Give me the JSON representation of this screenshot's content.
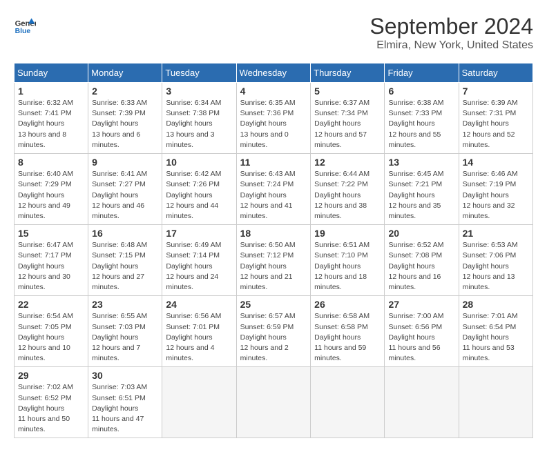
{
  "header": {
    "logo": {
      "line1": "General",
      "line2": "Blue"
    },
    "title": "September 2024",
    "subtitle": "Elmira, New York, United States"
  },
  "columns": [
    "Sunday",
    "Monday",
    "Tuesday",
    "Wednesday",
    "Thursday",
    "Friday",
    "Saturday"
  ],
  "weeks": [
    [
      {
        "day": "1",
        "sunrise": "6:32 AM",
        "sunset": "7:41 PM",
        "daylight": "13 hours and 8 minutes."
      },
      {
        "day": "2",
        "sunrise": "6:33 AM",
        "sunset": "7:39 PM",
        "daylight": "13 hours and 6 minutes."
      },
      {
        "day": "3",
        "sunrise": "6:34 AM",
        "sunset": "7:38 PM",
        "daylight": "13 hours and 3 minutes."
      },
      {
        "day": "4",
        "sunrise": "6:35 AM",
        "sunset": "7:36 PM",
        "daylight": "13 hours and 0 minutes."
      },
      {
        "day": "5",
        "sunrise": "6:37 AM",
        "sunset": "7:34 PM",
        "daylight": "12 hours and 57 minutes."
      },
      {
        "day": "6",
        "sunrise": "6:38 AM",
        "sunset": "7:33 PM",
        "daylight": "12 hours and 55 minutes."
      },
      {
        "day": "7",
        "sunrise": "6:39 AM",
        "sunset": "7:31 PM",
        "daylight": "12 hours and 52 minutes."
      }
    ],
    [
      {
        "day": "8",
        "sunrise": "6:40 AM",
        "sunset": "7:29 PM",
        "daylight": "12 hours and 49 minutes."
      },
      {
        "day": "9",
        "sunrise": "6:41 AM",
        "sunset": "7:27 PM",
        "daylight": "12 hours and 46 minutes."
      },
      {
        "day": "10",
        "sunrise": "6:42 AM",
        "sunset": "7:26 PM",
        "daylight": "12 hours and 44 minutes."
      },
      {
        "day": "11",
        "sunrise": "6:43 AM",
        "sunset": "7:24 PM",
        "daylight": "12 hours and 41 minutes."
      },
      {
        "day": "12",
        "sunrise": "6:44 AM",
        "sunset": "7:22 PM",
        "daylight": "12 hours and 38 minutes."
      },
      {
        "day": "13",
        "sunrise": "6:45 AM",
        "sunset": "7:21 PM",
        "daylight": "12 hours and 35 minutes."
      },
      {
        "day": "14",
        "sunrise": "6:46 AM",
        "sunset": "7:19 PM",
        "daylight": "12 hours and 32 minutes."
      }
    ],
    [
      {
        "day": "15",
        "sunrise": "6:47 AM",
        "sunset": "7:17 PM",
        "daylight": "12 hours and 30 minutes."
      },
      {
        "day": "16",
        "sunrise": "6:48 AM",
        "sunset": "7:15 PM",
        "daylight": "12 hours and 27 minutes."
      },
      {
        "day": "17",
        "sunrise": "6:49 AM",
        "sunset": "7:14 PM",
        "daylight": "12 hours and 24 minutes."
      },
      {
        "day": "18",
        "sunrise": "6:50 AM",
        "sunset": "7:12 PM",
        "daylight": "12 hours and 21 minutes."
      },
      {
        "day": "19",
        "sunrise": "6:51 AM",
        "sunset": "7:10 PM",
        "daylight": "12 hours and 18 minutes."
      },
      {
        "day": "20",
        "sunrise": "6:52 AM",
        "sunset": "7:08 PM",
        "daylight": "12 hours and 16 minutes."
      },
      {
        "day": "21",
        "sunrise": "6:53 AM",
        "sunset": "7:06 PM",
        "daylight": "12 hours and 13 minutes."
      }
    ],
    [
      {
        "day": "22",
        "sunrise": "6:54 AM",
        "sunset": "7:05 PM",
        "daylight": "12 hours and 10 minutes."
      },
      {
        "day": "23",
        "sunrise": "6:55 AM",
        "sunset": "7:03 PM",
        "daylight": "12 hours and 7 minutes."
      },
      {
        "day": "24",
        "sunrise": "6:56 AM",
        "sunset": "7:01 PM",
        "daylight": "12 hours and 4 minutes."
      },
      {
        "day": "25",
        "sunrise": "6:57 AM",
        "sunset": "6:59 PM",
        "daylight": "12 hours and 2 minutes."
      },
      {
        "day": "26",
        "sunrise": "6:58 AM",
        "sunset": "6:58 PM",
        "daylight": "11 hours and 59 minutes."
      },
      {
        "day": "27",
        "sunrise": "7:00 AM",
        "sunset": "6:56 PM",
        "daylight": "11 hours and 56 minutes."
      },
      {
        "day": "28",
        "sunrise": "7:01 AM",
        "sunset": "6:54 PM",
        "daylight": "11 hours and 53 minutes."
      }
    ],
    [
      {
        "day": "29",
        "sunrise": "7:02 AM",
        "sunset": "6:52 PM",
        "daylight": "11 hours and 50 minutes."
      },
      {
        "day": "30",
        "sunrise": "7:03 AM",
        "sunset": "6:51 PM",
        "daylight": "11 hours and 47 minutes."
      },
      null,
      null,
      null,
      null,
      null
    ]
  ]
}
